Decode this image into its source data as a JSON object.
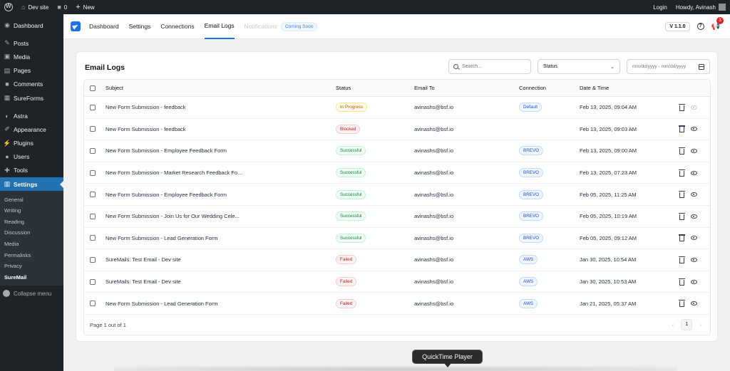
{
  "adminbar": {
    "site_name": "Dev site",
    "comments_count": "0",
    "new_label": "New",
    "login_label": "Login",
    "howdy": "Howdy, Avinash"
  },
  "sidebar": {
    "items": [
      {
        "label": "Dashboard",
        "icon": "dashboard-icon"
      },
      {
        "label": "Posts",
        "icon": "pin-icon"
      },
      {
        "label": "Media",
        "icon": "media-icon"
      },
      {
        "label": "Pages",
        "icon": "page-icon"
      },
      {
        "label": "Comments",
        "icon": "comment-icon"
      },
      {
        "label": "SureForms",
        "icon": "sureforms-icon"
      },
      {
        "label": "Astra",
        "icon": "astra-icon"
      },
      {
        "label": "Appearance",
        "icon": "brush-icon"
      },
      {
        "label": "Plugins",
        "icon": "plugin-icon"
      },
      {
        "label": "Users",
        "icon": "user-icon"
      },
      {
        "label": "Tools",
        "icon": "wrench-icon"
      },
      {
        "label": "Settings",
        "icon": "settings-icon"
      }
    ],
    "submenu": [
      "General",
      "Writing",
      "Reading",
      "Discussion",
      "Media",
      "Permalinks",
      "Privacy",
      "SureMail"
    ],
    "collapse_label": "Collapse menu"
  },
  "header": {
    "tabs": [
      "Dashboard",
      "Settings",
      "Connections",
      "Email Logs"
    ],
    "disabled_tab": "Notifications",
    "coming_soon": "Coming Soon",
    "version": "V 1.1.0",
    "help": "?",
    "notification_count": "3"
  },
  "logs": {
    "title": "Email Logs",
    "search_placeholder": "Search...",
    "status_filter": "Status",
    "date_placeholder": "mm/dd/yyyy - mm/dd/yyyy",
    "columns": {
      "subject": "Subject",
      "status": "Status",
      "email_to": "Email To",
      "connection": "Connection",
      "date": "Date & Time"
    },
    "rows": [
      {
        "subject": "New Form Submission - feedback",
        "status": "In Progress",
        "email": "avinashs@bsf.io",
        "connection": "Default",
        "date": "Feb 13, 2025, 09:04 AM"
      },
      {
        "subject": "New Form Submission - feedback",
        "status": "Blocked",
        "email": "avinashs@bsf.io",
        "connection": "",
        "date": "Feb 13, 2025, 09:03 AM"
      },
      {
        "subject": "New Form Submission - Employee Feedback Form",
        "status": "Successful",
        "email": "avinashs@bsf.io",
        "connection": "BREVO",
        "date": "Feb 13, 2025, 09:00 AM"
      },
      {
        "subject": "New Form Submission - Market Research Feedback Fo...",
        "status": "Successful",
        "email": "avinashs@bsf.io",
        "connection": "BREVO",
        "date": "Feb 13, 2025, 07:23 AM"
      },
      {
        "subject": "New Form Submission - Employee Feedback Form",
        "status": "Successful",
        "email": "avinashs@bsf.io",
        "connection": "BREVO",
        "date": "Feb 05, 2025, 11:25 AM"
      },
      {
        "subject": "New Form Submission - Join Us for Our Wedding Cele...",
        "status": "Successful",
        "email": "avinashs@bsf.io",
        "connection": "BREVO",
        "date": "Feb 05, 2025, 10:19 AM"
      },
      {
        "subject": "New Form Submission - Lead Generation Form",
        "status": "Successful",
        "email": "avinashs@bsf.io",
        "connection": "BREVO",
        "date": "Feb 05, 2025, 09:12 AM"
      },
      {
        "subject": "SureMails: Test Email - Dev site",
        "status": "Failed",
        "email": "avinashs@bsf.io",
        "connection": "AWS",
        "date": "Jan 30, 2025, 10:54 AM"
      },
      {
        "subject": "SureMails: Test Email - Dev site",
        "status": "Failed",
        "email": "avinashs@bsf.io",
        "connection": "AWS",
        "date": "Jan 30, 2025, 10:53 AM"
      },
      {
        "subject": "New Form Submission - Lead Generation Form",
        "status": "Failed",
        "email": "avinashs@bsf.io",
        "connection": "AWS",
        "date": "Jan 21, 2025, 05:37 AM"
      }
    ],
    "page_info": "Page 1 out of 1",
    "current_page": "1"
  },
  "tooltip": {
    "label": "QuickTime Player"
  },
  "colors": {
    "accent": "#2271b1",
    "brand": "#1a73e8",
    "admin_bg": "#1d2327"
  }
}
